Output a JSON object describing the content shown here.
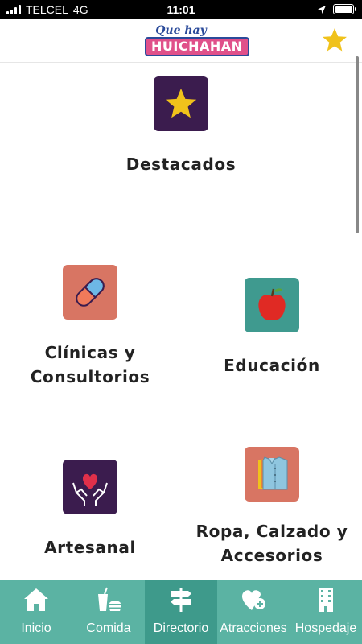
{
  "status_bar": {
    "carrier": "TELCEL",
    "network": "4G",
    "time": "11:01"
  },
  "header": {
    "logo_line1": "Que hay",
    "logo_line2": "HUICHAHAN",
    "favorite_icon": "star-icon"
  },
  "categories": [
    {
      "label": "Destacados",
      "icon": "star-icon",
      "color": "#3b1c4e"
    },
    {
      "label": "Clínicas y\nConsultorios",
      "icon": "pill-icon",
      "color": "#d87563"
    },
    {
      "label": "Educación",
      "icon": "apple-icon",
      "color": "#3f9a8f"
    },
    {
      "label": "Artesanal",
      "icon": "heart-hands-icon",
      "color": "#3b1c4e"
    },
    {
      "label": "Ropa, Calzado y\nAccesorios",
      "icon": "shirt-icon",
      "color": "#d87563"
    }
  ],
  "tabs": [
    {
      "label": "Inicio",
      "icon": "home-icon",
      "active": false
    },
    {
      "label": "Comida",
      "icon": "food-icon",
      "active": false
    },
    {
      "label": "Directorio",
      "icon": "signpost-icon",
      "active": true
    },
    {
      "label": "Atracciones",
      "icon": "heart-plus-icon",
      "active": false
    },
    {
      "label": "Hospedaje",
      "icon": "building-icon",
      "active": false
    }
  ],
  "colors": {
    "tabbar": "#5bb3a3",
    "tab_active": "#3e9a8b",
    "star": "#f0c21b"
  }
}
